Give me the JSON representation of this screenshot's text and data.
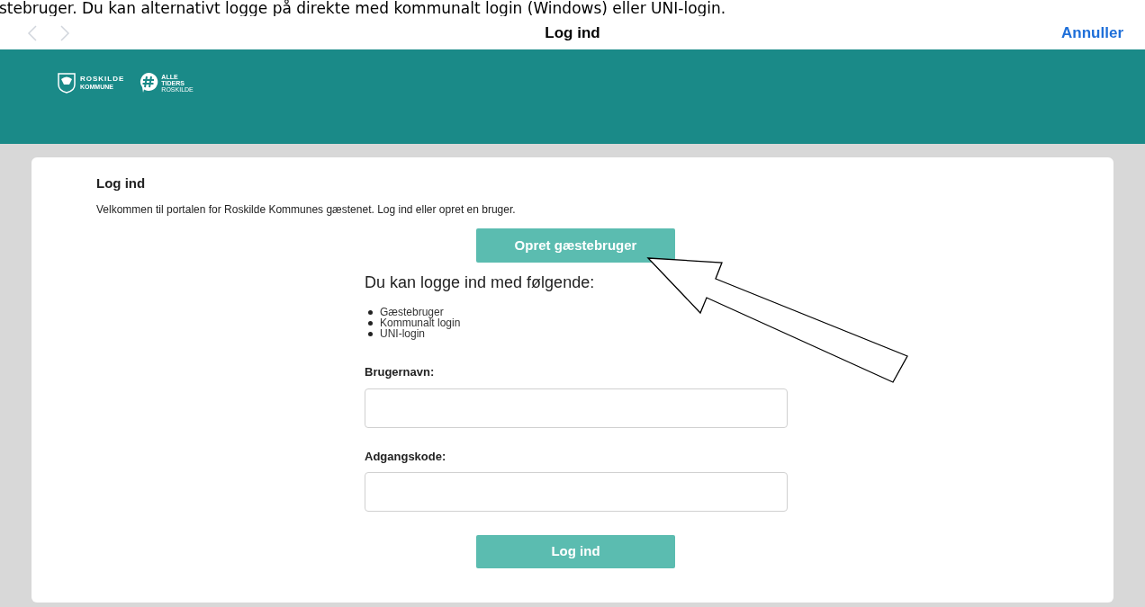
{
  "caption": "stebruger. Du kan alternativt logge på direkte med kommunalt login (Windows) eller UNI-login.",
  "nav_bar": {
    "back_enabled": false,
    "forward_enabled": false,
    "title": "Log ind",
    "action": "Annuller"
  },
  "header": {
    "logo_name": "ROSKILDE",
    "logo_sub": "KOMMUNE",
    "badge_lines": [
      "ALLE",
      "TIDERS",
      "ROSKILDE"
    ]
  },
  "card": {
    "title": "Log ind",
    "intro": "Velkommen til portalen for Roskilde Kommunes gæstenet. Log ind eller opret en bruger.",
    "create_button": "Opret gæstebruger",
    "methods_heading": "Du kan logge ind med følgende:",
    "methods": [
      "Gæstebruger",
      "Kommunalt login",
      "UNI-login"
    ],
    "fields": [
      {
        "label": "Brugernavn:"
      },
      {
        "label": "Adgangskode:"
      }
    ],
    "submit_button": "Log ind"
  }
}
